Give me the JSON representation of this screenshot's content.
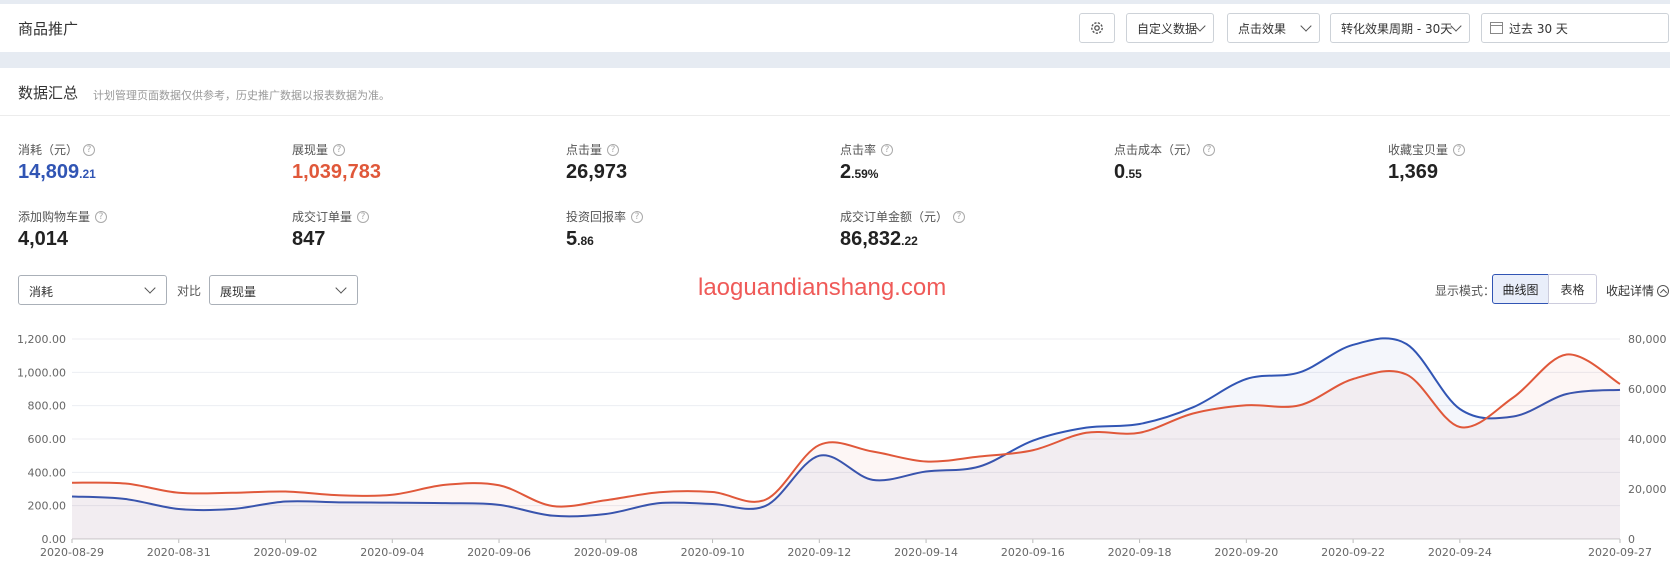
{
  "header": {
    "title": "商品推广",
    "custom_data": "自定义数据",
    "click_effect": "点击效果",
    "conversion_cycle": "转化效果周期 - 30天",
    "date_range": "过去 30 天"
  },
  "summary": {
    "title": "数据汇总",
    "note": "计划管理页面数据仅供参考，历史推广数据以报表数据为准。"
  },
  "metrics": [
    {
      "label": "消耗（元）",
      "int": "14,809",
      "dec": ".21",
      "color": "#3155b4"
    },
    {
      "label": "展现量",
      "int": "1,039,783",
      "dec": "",
      "color": "#e0583a"
    },
    {
      "label": "点击量",
      "int": "26,973",
      "dec": "",
      "color": "#222222"
    },
    {
      "label": "点击率",
      "int": "2",
      "dec": ".59%",
      "color": "#222222"
    },
    {
      "label": "点击成本（元）",
      "int": "0",
      "dec": ".55",
      "color": "#222222"
    },
    {
      "label": "收藏宝贝量",
      "int": "1,369",
      "dec": "",
      "color": "#222222"
    },
    {
      "label": "添加购物车量",
      "int": "4,014",
      "dec": "",
      "color": "#222222"
    },
    {
      "label": "成交订单量",
      "int": "847",
      "dec": "",
      "color": "#222222"
    },
    {
      "label": "投资回报率",
      "int": "5",
      "dec": ".86",
      "color": "#222222"
    },
    {
      "label": "成交订单金额（元）",
      "int": "86,832",
      "dec": ".22",
      "color": "#222222"
    }
  ],
  "controls": {
    "left_select": "消耗",
    "compare_label": "对比",
    "right_select": "展现量",
    "watermark": "laoguandianshang.com",
    "mode_label": "显示模式：",
    "mode_curve": "曲线图",
    "mode_table": "表格",
    "collapse": "收起详情"
  },
  "chart_data": {
    "type": "line",
    "x": [
      "2020-08-29",
      "2020-08-30",
      "2020-08-31",
      "2020-09-01",
      "2020-09-02",
      "2020-09-03",
      "2020-09-04",
      "2020-09-05",
      "2020-09-06",
      "2020-09-07",
      "2020-09-08",
      "2020-09-09",
      "2020-09-10",
      "2020-09-11",
      "2020-09-12",
      "2020-09-13",
      "2020-09-14",
      "2020-09-15",
      "2020-09-16",
      "2020-09-17",
      "2020-09-18",
      "2020-09-19",
      "2020-09-20",
      "2020-09-21",
      "2020-09-22",
      "2020-09-23",
      "2020-09-24",
      "2020-09-25",
      "2020-09-26",
      "2020-09-27"
    ],
    "x_tick_labels": [
      "2020-08-29",
      "2020-08-31",
      "2020-09-02",
      "2020-09-04",
      "2020-09-06",
      "2020-09-08",
      "2020-09-10",
      "2020-09-12",
      "2020-09-14",
      "2020-09-16",
      "2020-09-18",
      "2020-09-20",
      "2020-09-22",
      "2020-09-24",
      "2020-09-27"
    ],
    "y_left_ticks": [
      "0.00",
      "200.00",
      "400.00",
      "600.00",
      "800.00",
      "1,000.00",
      "1,200.00"
    ],
    "y_left_range": [
      0,
      1200
    ],
    "y_right_ticks": [
      "0",
      "20,000",
      "40,000",
      "60,000",
      "80,000"
    ],
    "y_right_range": [
      0,
      80000
    ],
    "series": [
      {
        "axis": "left",
        "color": "#3155b4",
        "values": [
          255,
          240,
          180,
          180,
          225,
          220,
          218,
          215,
          205,
          140,
          150,
          215,
          210,
          200,
          500,
          355,
          405,
          435,
          590,
          668,
          690,
          790,
          960,
          1000,
          1165,
          1170,
          780,
          735,
          870,
          895
        ]
      },
      {
        "axis": "right",
        "color": "#e0583a",
        "values": [
          22500,
          22200,
          18500,
          18500,
          19000,
          17500,
          17700,
          21700,
          21500,
          13200,
          15500,
          18700,
          18800,
          15800,
          37600,
          35000,
          31000,
          33000,
          35500,
          42500,
          42500,
          50200,
          53500,
          53500,
          64000,
          65800,
          44800,
          56600,
          73800,
          62000
        ]
      }
    ],
    "grid": true
  }
}
